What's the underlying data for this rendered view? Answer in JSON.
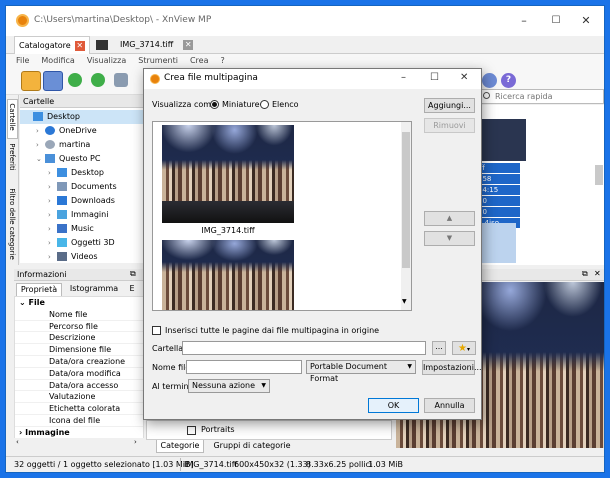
{
  "window": {
    "title": "C:\\Users\\martina\\Desktop\\ - XnView MP",
    "controls": [
      "–",
      "☐",
      "✕"
    ]
  },
  "tabs": [
    {
      "label": "Catalogatore",
      "close": "✕"
    },
    {
      "label": "IMG_3714.tiff",
      "close": "✕"
    }
  ],
  "menu": [
    "File",
    "Modifica",
    "Visualizza",
    "Strumenti",
    "Crea",
    "?"
  ],
  "search": {
    "placeholder": "Ricerca rapida"
  },
  "folders_panel": {
    "title": "Cartelle",
    "side_tabs": [
      "Cartelle",
      "Preferiti",
      "Filtro delle categorie"
    ],
    "items": [
      {
        "label": "Desktop",
        "icon": "folder-blue-icon",
        "selected": true
      },
      {
        "label": "OneDrive",
        "icon": "cloud-icon"
      },
      {
        "label": "martina",
        "icon": "user-icon"
      },
      {
        "label": "Questo PC",
        "icon": "computer-icon",
        "expanded": true
      },
      {
        "label": "Desktop",
        "icon": "folder-blue-icon"
      },
      {
        "label": "Documents",
        "icon": "documents-icon"
      },
      {
        "label": "Downloads",
        "icon": "download-icon"
      },
      {
        "label": "Immagini",
        "icon": "pictures-icon"
      },
      {
        "label": "Music",
        "icon": "music-icon"
      },
      {
        "label": "Oggetti 3D",
        "icon": "cube-icon"
      },
      {
        "label": "Videos",
        "icon": "video-icon"
      }
    ]
  },
  "info_panel": {
    "title": "Informazioni",
    "tabs": [
      "Proprietà",
      "Istogramma",
      "E"
    ],
    "group": "File",
    "rows": [
      "Nome file",
      "Percorso file",
      "Descrizione",
      "Dimensione file",
      "Data/ora creazione",
      "Data/ora modifica",
      "Data/ora accesso",
      "Valutazione",
      "Etichetta colorata",
      "Icona del file"
    ],
    "next_group": "Immagine"
  },
  "right_overlay": {
    "values": [
      "iff",
      "058",
      "44:15",
      "30",
      "30",
      "5 4iso"
    ]
  },
  "categories_panel": {
    "items": [
      "Portraits"
    ],
    "tabs": [
      "Categorie",
      "Gruppi di categorie"
    ]
  },
  "dialog": {
    "title": "Crea file multipagina",
    "view_label": "Visualizza come:",
    "view_options": [
      "Miniature",
      "Elenco"
    ],
    "view_selected": "Miniature",
    "thumbnails": [
      {
        "caption": "IMG_3714.tiff"
      },
      {
        "caption": ""
      }
    ],
    "buttons": {
      "add": "Aggiungi...",
      "remove": "Rimuovi",
      "up": "▲",
      "down": "▼",
      "ok": "OK",
      "cancel": "Annulla",
      "settings": "Impostazioni...",
      "browse": "..."
    },
    "insert_all_label": "Inserisci tutte le pagine dai file multipagina in origine",
    "folder_label": "Cartella",
    "folder_value": "",
    "filename_label": "Nome file",
    "filename_value": "",
    "format_value": "Portable Document Format",
    "at_end_label": "Al termine",
    "at_end_value": "Nessuna azione"
  },
  "statusbar": {
    "count": "32 oggetti / 1 oggetto selezionato [1.03 MiB]",
    "filename": "IMG_3714.tiff",
    "dims": "600x450x32 (1.33)",
    "print_size": "8.33x6.25 pollici",
    "size": "1.03 MiB"
  }
}
